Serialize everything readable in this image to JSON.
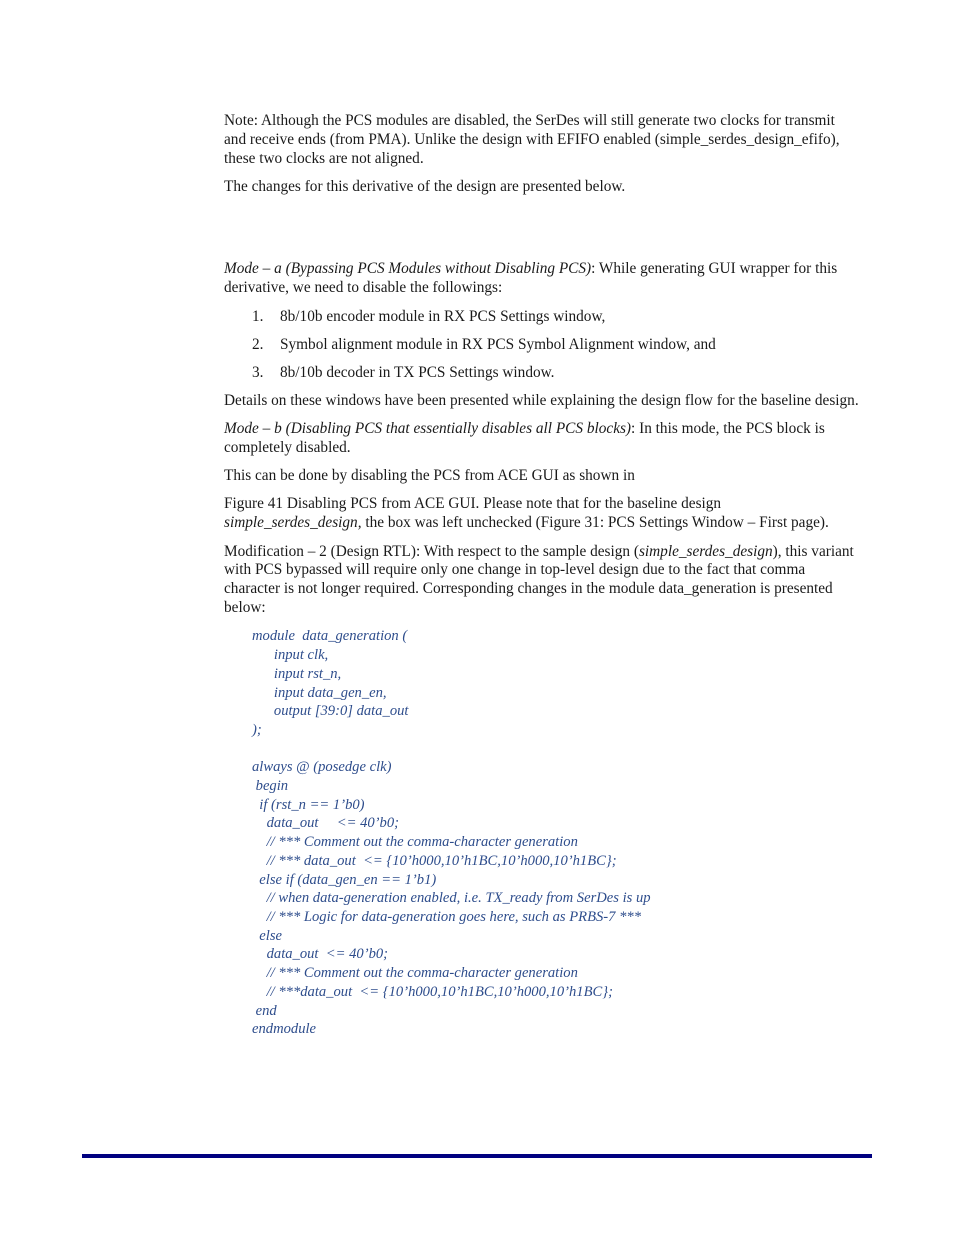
{
  "document": {
    "note_paragraph": "Note: Although the PCS modules are disabled, the SerDes will still generate two clocks for transmit and receive ends (from PMA). Unlike the design with EFIFO enabled (simple_serdes_design_efifo), these two clocks are not aligned.",
    "changes_intro": "The changes for this derivative of the design are presented below.",
    "mode_a": {
      "label": "Mode – a (Bypassing PCS Modules without Disabling PCS)",
      "text": ": While generating GUI wrapper for this derivative, we need to disable the followings:"
    },
    "steps": [
      {
        "num": "1.",
        "text": "8b/10b encoder module in RX PCS Settings window,"
      },
      {
        "num": "2.",
        "text": "Symbol alignment module in RX PCS Symbol Alignment window, and"
      },
      {
        "num": "3.",
        "text": "8b/10b decoder in TX PCS Settings window."
      }
    ],
    "details_paragraph": "Details on these windows have been presented while explaining the design flow for the baseline design.",
    "mode_b": {
      "label": "Mode – b (Disabling PCS that essentially disables all PCS blocks)",
      "text": ": In this mode, the PCS block is completely disabled."
    },
    "disable_paragraph": "This can be done by disabling the PCS from ACE GUI as shown in",
    "figure_paragraph": {
      "part1": "Figure 41 Disabling PCS from ACE GUI. Please note that for the baseline design ",
      "italic": "simple_serdes_design,",
      "part2": " the box was left unchecked (Figure 31: PCS Settings Window – First page)."
    },
    "modification_paragraph": {
      "part1": "Modification – 2 (Design RTL): With respect to the sample design (",
      "italic": "simple_serdes_design",
      "part2": "), this variant with PCS bypassed will require only one change in top-level design due to the fact that comma character is not longer required. Corresponding changes in the module data_generation is presented below:"
    },
    "code_lines": [
      "module  data_generation (",
      "      input clk,",
      "      input rst_n,",
      "      input data_gen_en,",
      "      output [39:0] data_out",
      ");",
      "",
      "always @ (posedge clk)",
      " begin",
      "  if (rst_n == 1’b0)",
      "    data_out     <= 40’b0;",
      "    // *** Comment out the comma-character generation",
      "    // *** data_out  <= {10’h000,10’h1BC,10’h000,10’h1BC};",
      "  else if (data_gen_en == 1’b1)",
      "    // when data-generation enabled, i.e. TX_ready from SerDes is up",
      "    // *** Logic for data-generation goes here, such as PRBS-7 ***",
      "  else",
      "    data_out  <= 40’b0;",
      "    // *** Comment out the comma-character generation",
      "    // ***data_out  <= {10’h000,10’h1BC,10’h000,10’h1BC};",
      " end",
      "endmodule"
    ],
    "colors": {
      "code_text": "#2e4d8c",
      "footer_rule": "#000080"
    }
  }
}
